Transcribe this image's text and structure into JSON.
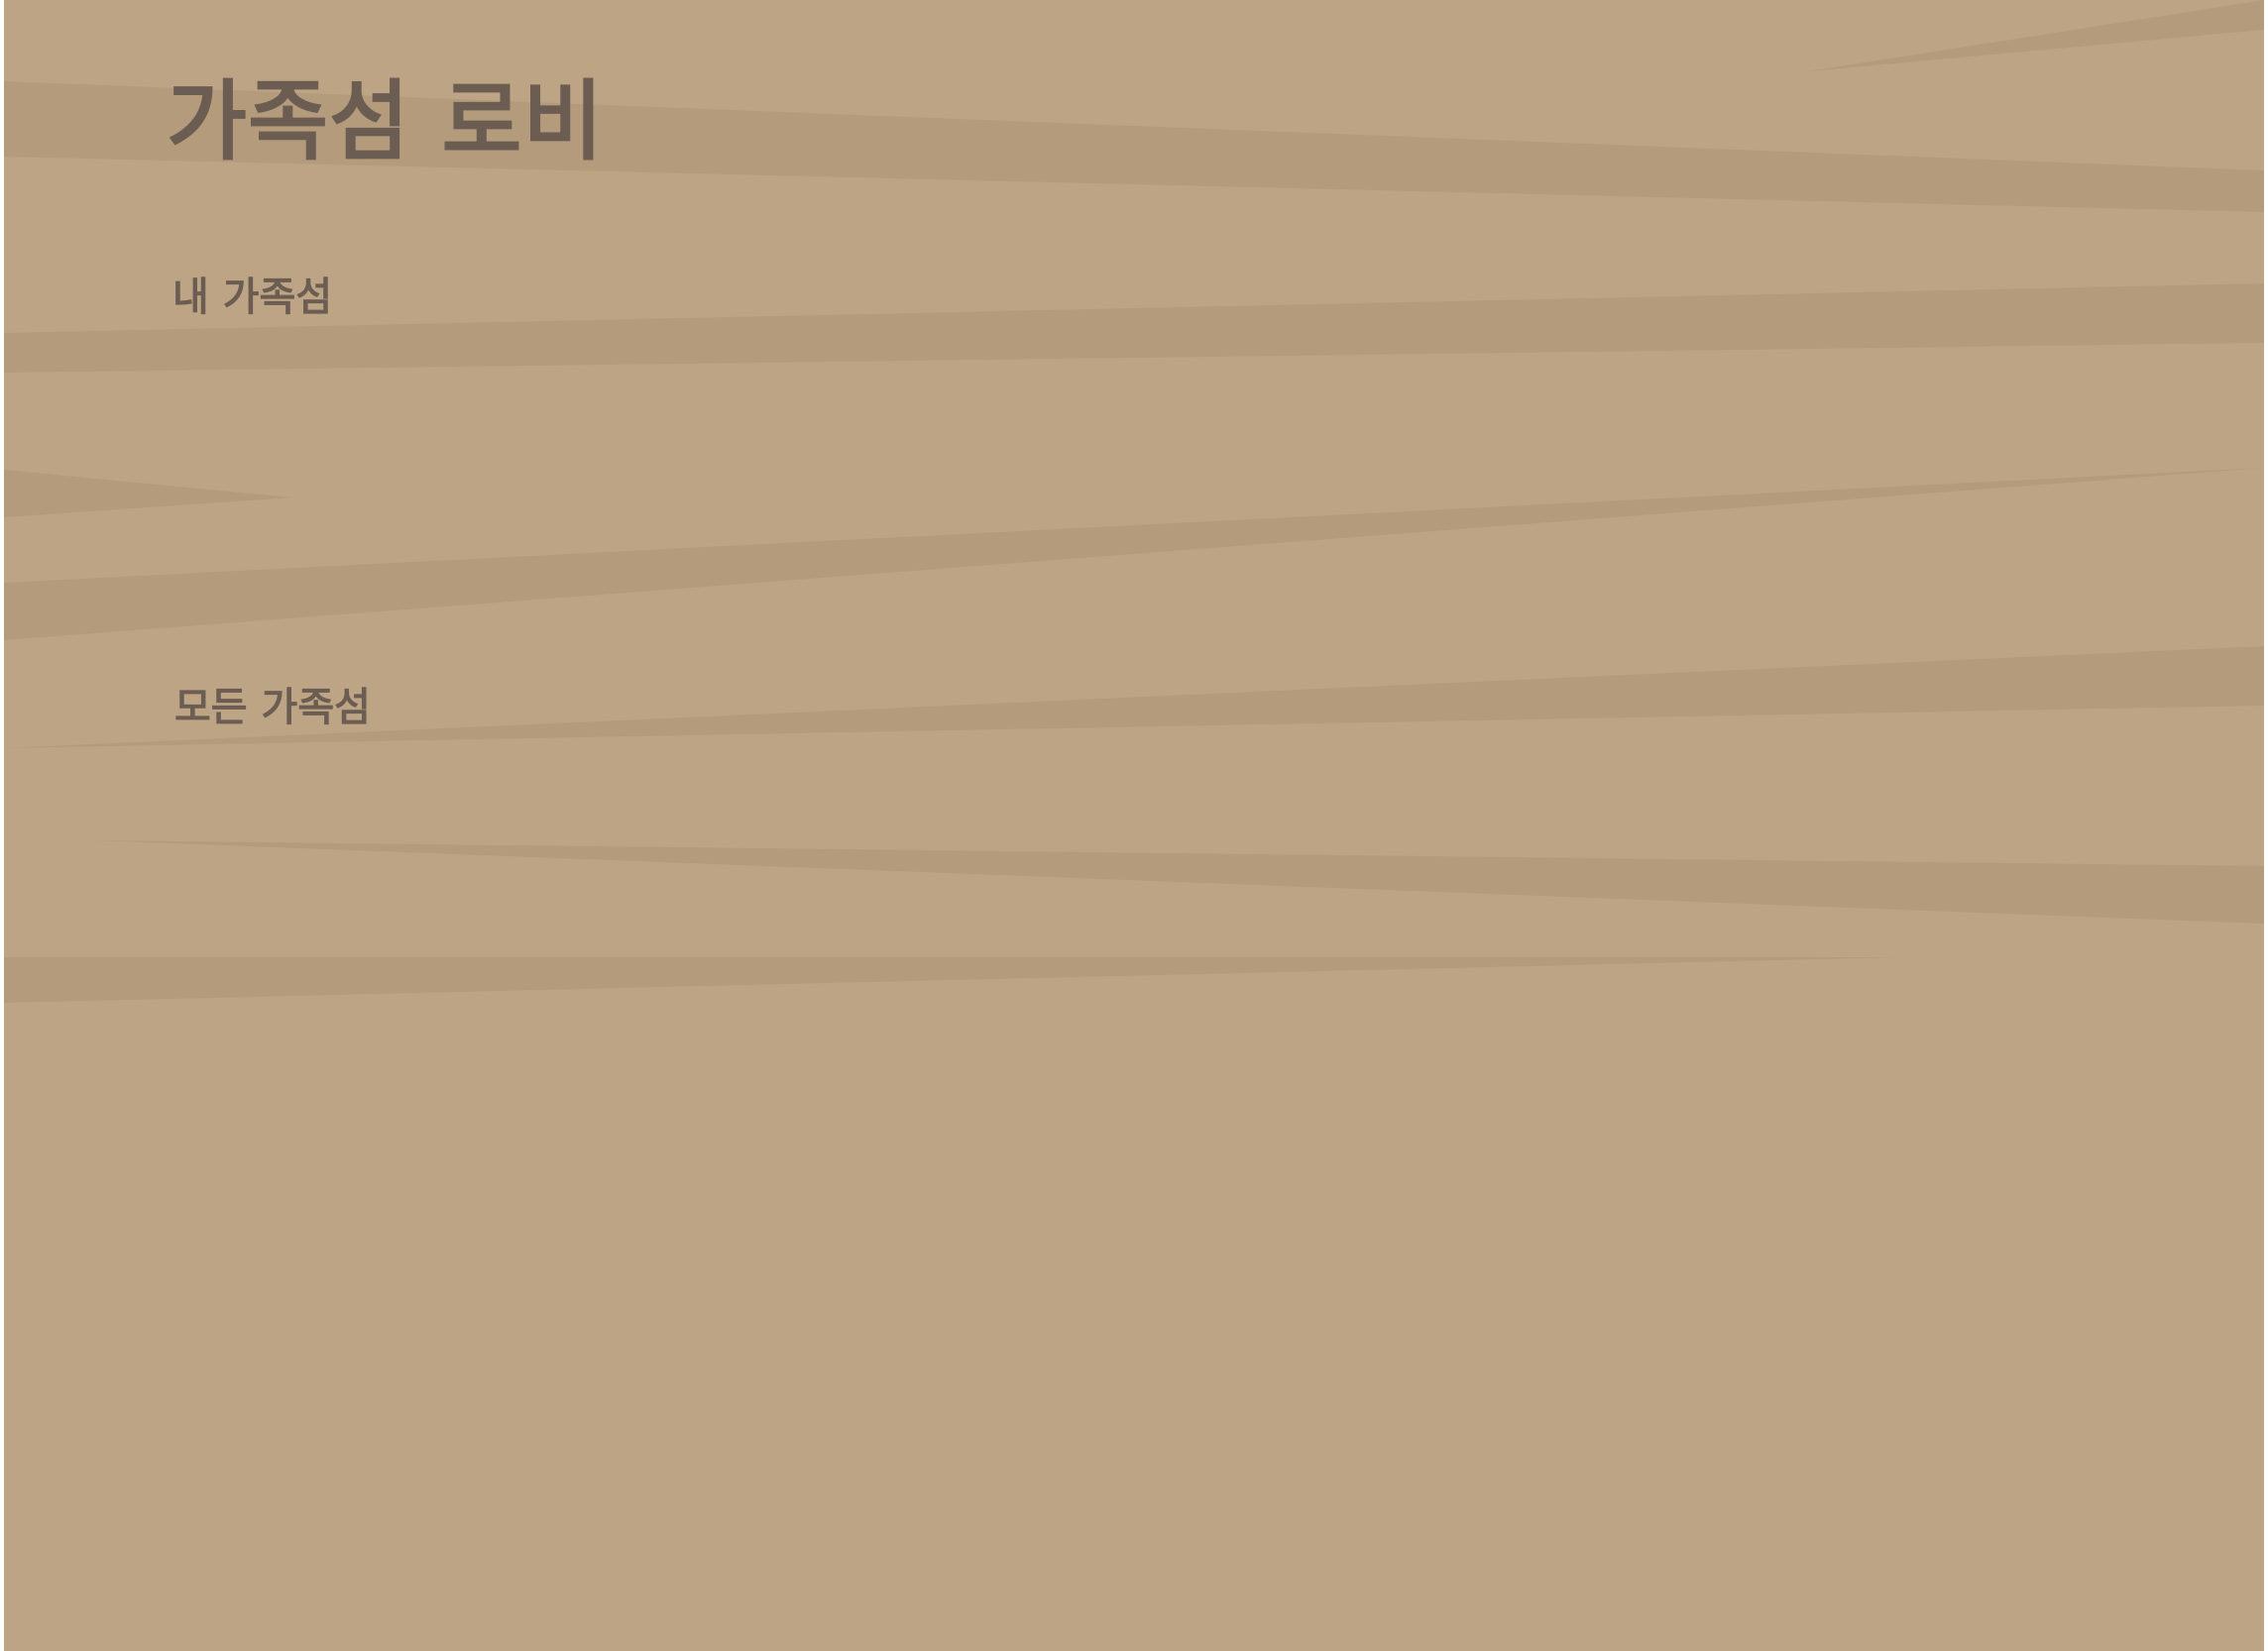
{
  "lobby": {
    "title": "가족섬 로비",
    "background_color": "#bda485",
    "stripe_color": "#b39b7c",
    "text_color": "#6b5d52"
  },
  "my_islands": {
    "heading": "내 가족섬",
    "items": []
  },
  "all_islands": {
    "heading": "모든 가족섬",
    "items": []
  }
}
